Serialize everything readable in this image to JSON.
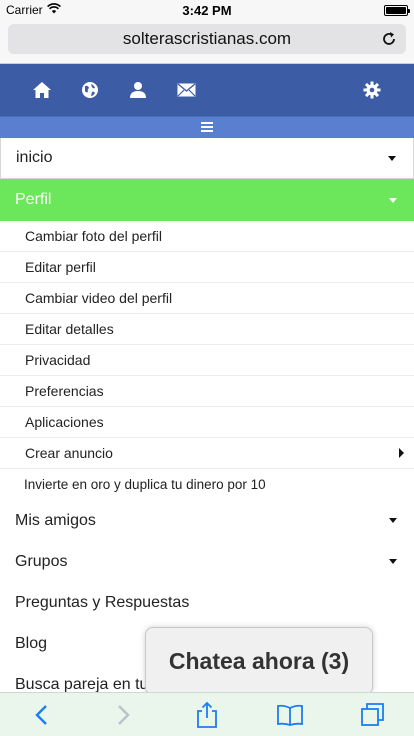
{
  "status_bar": {
    "carrier": "Carrier",
    "time": "3:42 PM"
  },
  "browser": {
    "url": "solterascristianas.com"
  },
  "navbar": {
    "icons": [
      "home-icon",
      "globe-icon",
      "user-icon",
      "mail-icon",
      "gear-icon"
    ],
    "menu_toggle_icon": "hamburger-icon"
  },
  "menu": {
    "inicio": "inicio",
    "perfil": "Perfil",
    "perfil_items": [
      "Cambiar foto del perfil",
      "Editar perfil",
      "Cambiar video del perfil",
      "Editar detalles",
      "Privacidad",
      "Preferencias",
      "Aplicaciones",
      "Crear anuncio",
      "Invierte en oro y duplica tu dinero por 10"
    ],
    "mis_amigos": "Mis amigos",
    "grupos": "Grupos",
    "preguntas": "Preguntas y Respuestas",
    "blog": "Blog",
    "busca_pareja": "Busca pareja en tu"
  },
  "chat": {
    "label": "Chatea ahora (3)"
  },
  "colors": {
    "navbar": "#3c5da6",
    "menu_toggle": "#5a7fd0",
    "perfil_active": "#6ce65a",
    "toolbar_tint": "#1a7ef2"
  },
  "toolbar": {
    "icons": [
      "back-icon",
      "forward-icon",
      "share-icon",
      "bookmarks-icon",
      "tabs-icon"
    ]
  }
}
